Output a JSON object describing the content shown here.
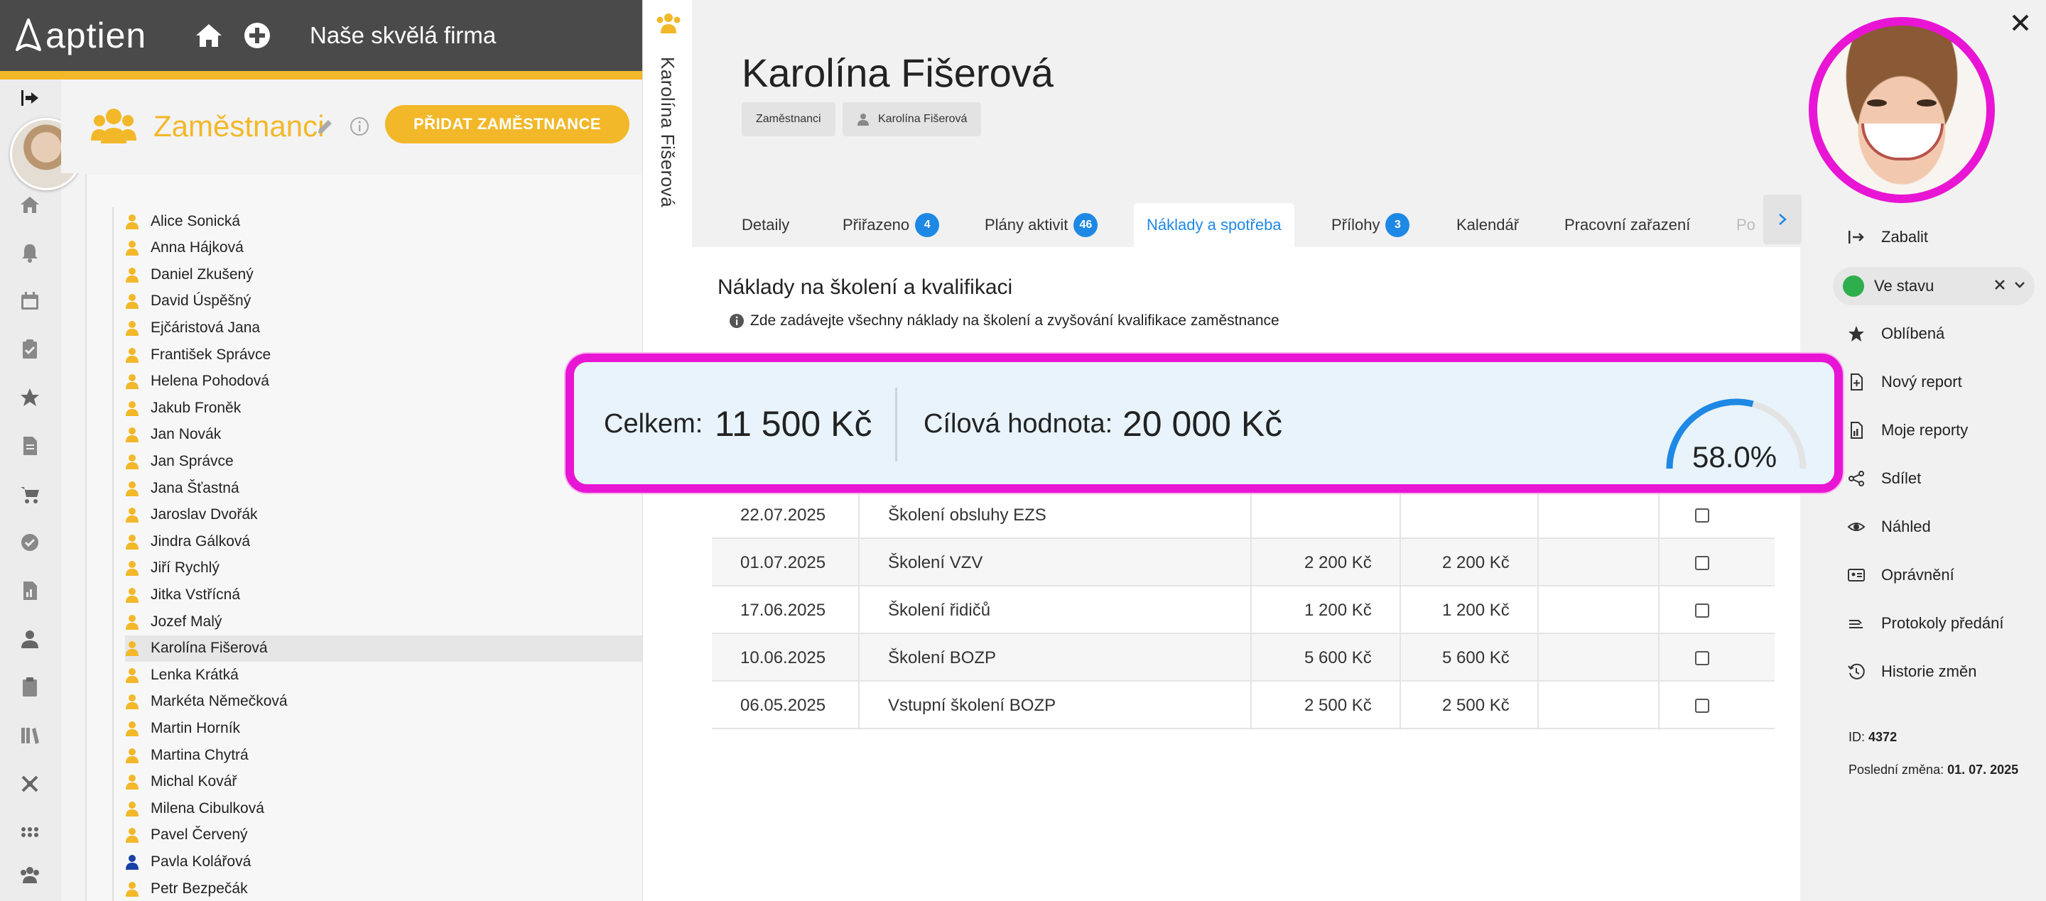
{
  "app": {
    "logo_text": "aptien",
    "company": "Naše skvělá firma"
  },
  "employees_panel": {
    "title": "Zaměstnanci",
    "add_button": "PŘIDAT ZAMĚSTNANCE",
    "items": [
      "Alice Sonická",
      "Anna Hájková",
      "Daniel Zkušený",
      "David Úspěšný",
      "Ejčáristová Jana",
      "František Správce",
      "Helena Pohodová",
      "Jakub Froněk",
      "Jan Novák",
      "Jan Správce",
      "Jana Šťastná",
      "Jaroslav Dvořák",
      "Jindra Gálková",
      "Jiří Rychlý",
      "Jitka Vstřícná",
      "Jozef Malý",
      "Karolína Fišerová",
      "Lenka Krátká",
      "Markéta Němečková",
      "Martin Horník",
      "Martina Chytrá",
      "Michal Kovář",
      "Milena Cibulková",
      "Pavel Červený",
      "Pavla Kolářová",
      "Petr Bezpečák"
    ],
    "selected": "Karolína Fišerová"
  },
  "detail": {
    "vertical_title": "Karolína Fišerová",
    "name": "Karolína Fišerová",
    "breadcrumbs": [
      "Zaměstnanci",
      "Karolína Fišerová"
    ],
    "tabs": [
      {
        "label": "Detaily"
      },
      {
        "label": "Přiřazeno",
        "badge": "4"
      },
      {
        "label": "Plány aktivit",
        "badge": "46"
      },
      {
        "label": "Náklady a spotřeba"
      },
      {
        "label": "Přílohy",
        "badge": "3"
      },
      {
        "label": "Kalendář"
      },
      {
        "label": "Pracovní zařazení"
      },
      {
        "label": "Po"
      }
    ],
    "active_tab": "Náklady a spotřeba",
    "section_title": "Náklady na školení a kvalifikaci",
    "section_note": "Zde zadávejte všechny náklady na školení a zvyšování kvalifikace zaměstnance",
    "summary": {
      "total_label": "Celkem:",
      "total_value": "11 500 Kč",
      "target_label": "Cílová hodnota:",
      "target_value": "20 000 Kč",
      "percent_text": "58.0%",
      "percent": 58.0
    },
    "rows": [
      {
        "date": "22.07.2025",
        "name": "Školení obsluhy EZS",
        "cost": "",
        "paid": "",
        "checked": false
      },
      {
        "date": "01.07.2025",
        "name": "Školení VZV",
        "cost": "2 200 Kč",
        "paid": "2 200 Kč",
        "checked": false
      },
      {
        "date": "17.06.2025",
        "name": "Školení řidičů",
        "cost": "1 200 Kč",
        "paid": "1 200 Kč",
        "checked": false
      },
      {
        "date": "10.06.2025",
        "name": "Školení BOZP",
        "cost": "5 600 Kč",
        "paid": "5 600 Kč",
        "checked": false
      },
      {
        "date": "06.05.2025",
        "name": "Vstupní školení BOZP",
        "cost": "2 500 Kč",
        "paid": "2 500 Kč",
        "checked": false
      }
    ]
  },
  "right_panel": {
    "state": "Ve stavu",
    "actions": [
      "Zabalit",
      "Oblíbená",
      "Nový report",
      "Moje reporty",
      "Sdílet",
      "Náhled",
      "Oprávnění",
      "Protokoly předání",
      "Historie změn"
    ],
    "id_label": "ID:",
    "id_value": "4372",
    "last_change_label": "Poslední změna:",
    "last_change_value": "01. 07. 2025"
  },
  "colors": {
    "accent": "#f2b829",
    "link": "#1e88e5",
    "highlight": "#e815d4",
    "state_ok": "#2eae4c"
  }
}
